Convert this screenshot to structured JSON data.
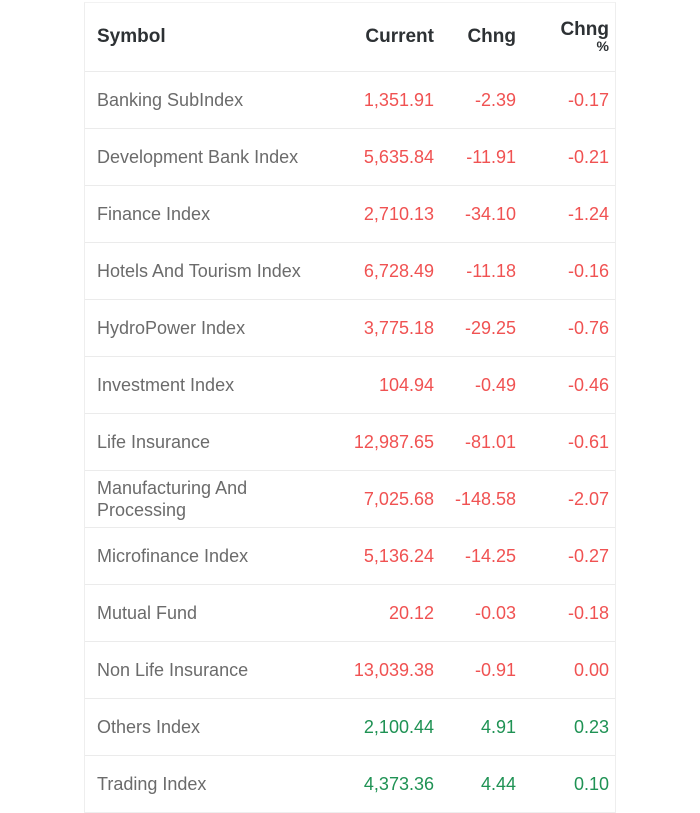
{
  "table": {
    "columns": [
      {
        "key": "symbol",
        "label": "Symbol",
        "align": "left"
      },
      {
        "key": "current",
        "label": "Current",
        "align": "right"
      },
      {
        "key": "chng",
        "label": "Chng",
        "align": "right"
      },
      {
        "key": "chng_pct",
        "label": "Chng",
        "sub_label": "%",
        "align": "right"
      }
    ],
    "colors": {
      "down": "#f05252",
      "up": "#1f9254",
      "symbol_text": "#6b6b6b",
      "header_text": "#2d3134",
      "row_divider": "#ebebeb",
      "card_border": "#eeeeee",
      "background": "#ffffff"
    },
    "rows": [
      {
        "symbol": "Banking SubIndex",
        "current": "1,351.91",
        "chng": "-2.39",
        "chng_pct": "-0.17",
        "direction": "down"
      },
      {
        "symbol": "Development Bank Index",
        "current": "5,635.84",
        "chng": "-11.91",
        "chng_pct": "-0.21",
        "direction": "down"
      },
      {
        "symbol": "Finance Index",
        "current": "2,710.13",
        "chng": "-34.10",
        "chng_pct": "-1.24",
        "direction": "down"
      },
      {
        "symbol": "Hotels And Tourism Index",
        "current": "6,728.49",
        "chng": "-11.18",
        "chng_pct": "-0.16",
        "direction": "down"
      },
      {
        "symbol": "HydroPower Index",
        "current": "3,775.18",
        "chng": "-29.25",
        "chng_pct": "-0.76",
        "direction": "down"
      },
      {
        "symbol": "Investment Index",
        "current": "104.94",
        "chng": "-0.49",
        "chng_pct": "-0.46",
        "direction": "down"
      },
      {
        "symbol": "Life Insurance",
        "current": "12,987.65",
        "chng": "-81.01",
        "chng_pct": "-0.61",
        "direction": "down"
      },
      {
        "symbol": "Manufacturing And Processing",
        "current": "7,025.68",
        "chng": "-148.58",
        "chng_pct": "-2.07",
        "direction": "down"
      },
      {
        "symbol": "Microfinance Index",
        "current": "5,136.24",
        "chng": "-14.25",
        "chng_pct": "-0.27",
        "direction": "down"
      },
      {
        "symbol": "Mutual Fund",
        "current": "20.12",
        "chng": "-0.03",
        "chng_pct": "-0.18",
        "direction": "down"
      },
      {
        "symbol": "Non Life Insurance",
        "current": "13,039.38",
        "chng": "-0.91",
        "chng_pct": "0.00",
        "direction": "down"
      },
      {
        "symbol": "Others Index",
        "current": "2,100.44",
        "chng": "4.91",
        "chng_pct": "0.23",
        "direction": "up"
      },
      {
        "symbol": "Trading Index",
        "current": "4,373.36",
        "chng": "4.44",
        "chng_pct": "0.10",
        "direction": "up"
      }
    ]
  }
}
